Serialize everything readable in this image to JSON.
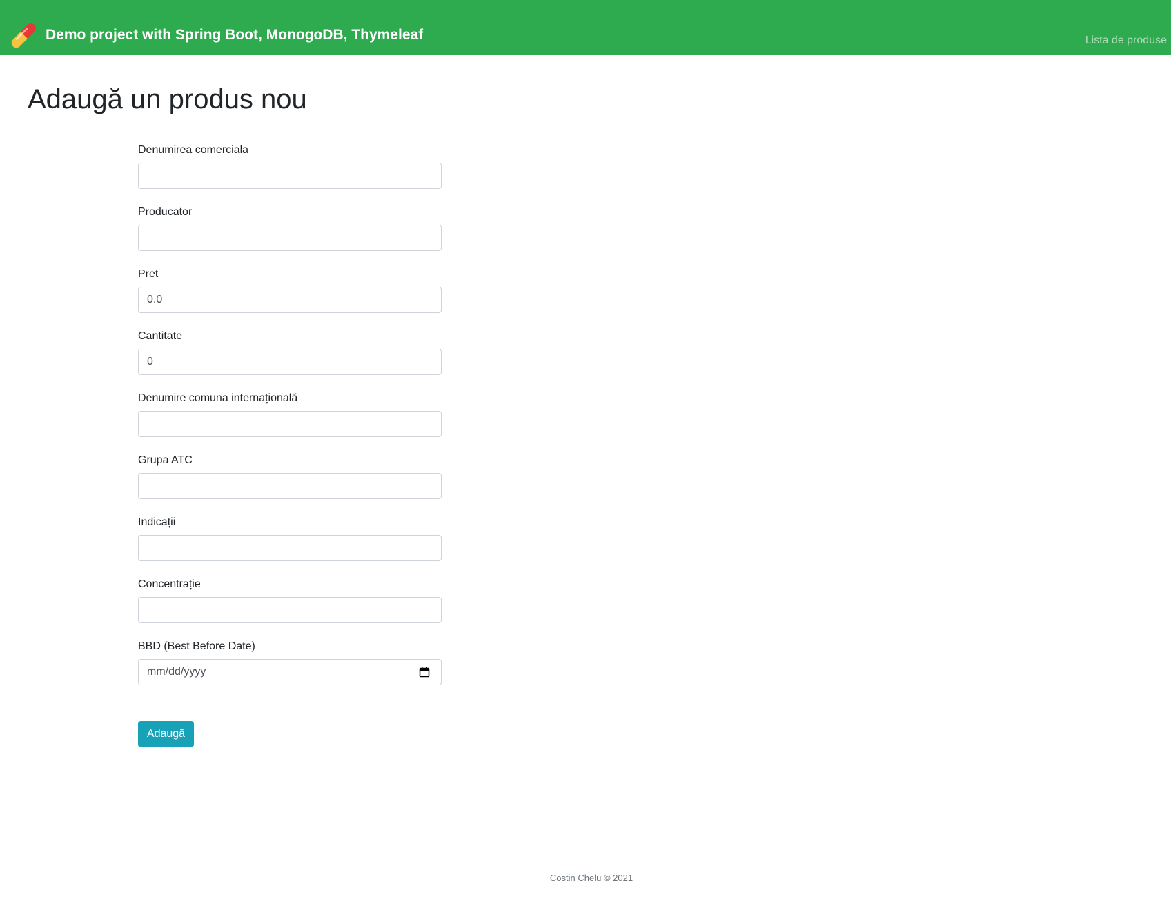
{
  "navbar": {
    "brand_icon": "pill-icon",
    "brand_text": "Demo project with Spring Boot, MonogoDB, Thymeleaf",
    "nav_link": "Lista de produse",
    "background_color": "#2eaa4f"
  },
  "page": {
    "title": "Adaugă un produs nou"
  },
  "form": {
    "fields": [
      {
        "label": "Denumirea comerciala",
        "value": "",
        "placeholder": ""
      },
      {
        "label": "Producator",
        "value": "",
        "placeholder": ""
      },
      {
        "label": "Pret",
        "value": "0.0",
        "placeholder": ""
      },
      {
        "label": "Cantitate",
        "value": "0",
        "placeholder": ""
      },
      {
        "label": "Denumire comuna internațională",
        "value": "",
        "placeholder": ""
      },
      {
        "label": "Grupa ATC",
        "value": "",
        "placeholder": ""
      },
      {
        "label": "Indicații",
        "value": "",
        "placeholder": ""
      },
      {
        "label": "Concentrație",
        "value": "",
        "placeholder": ""
      },
      {
        "label": "BBD (Best Before Date)",
        "value": "mm/dd/yyyy",
        "placeholder": ""
      }
    ],
    "submit_label": "Adaugă",
    "submit_color": "#17a2b8"
  },
  "footer": {
    "text": "Costin Chelu © 2021"
  }
}
